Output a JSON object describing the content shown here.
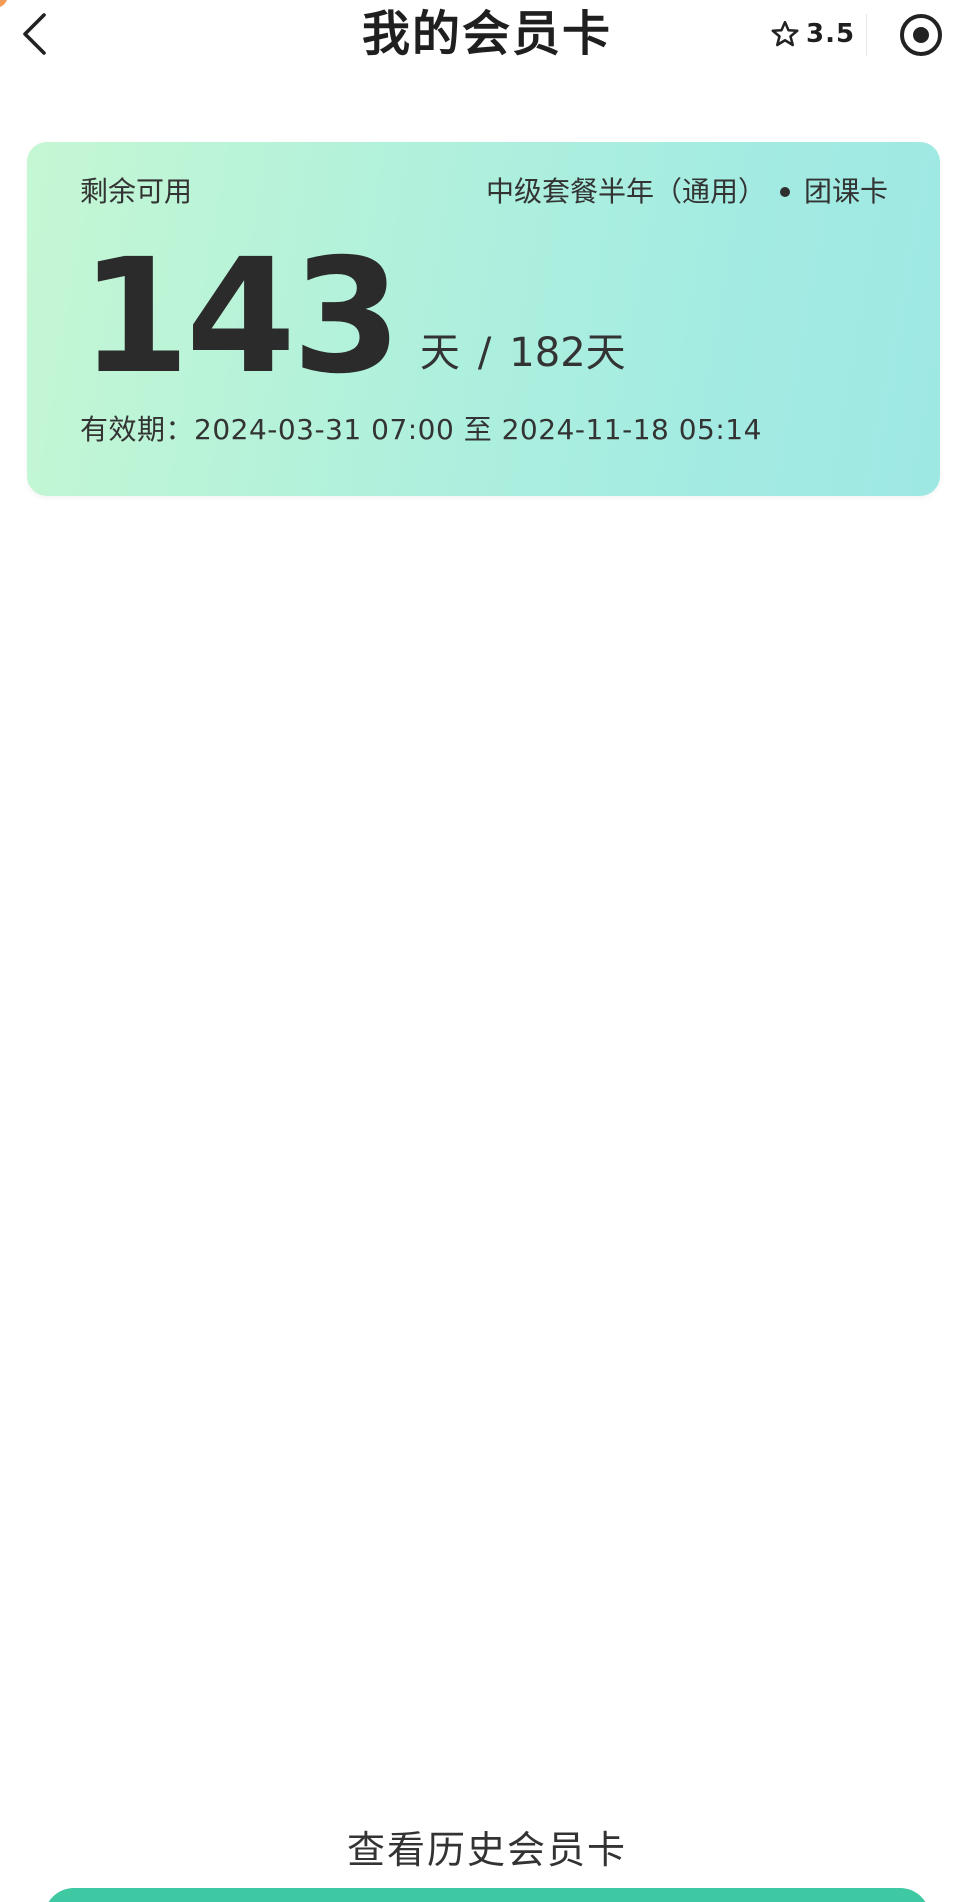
{
  "header": {
    "title": "我的会员卡",
    "back_icon": "chevron-left-icon",
    "rating_icon": "star-outline-icon",
    "rating_value": "3.5",
    "target_icon": "target-icon"
  },
  "card": {
    "label": "剩余可用",
    "plan_name": "中级套餐半年（通用）",
    "card_type": "团课卡",
    "days_remaining": "143",
    "days_unit": "天",
    "separator": "/",
    "days_total": "182天",
    "validity": "有效期：2024-03-31 07:00 至 2024-11-18 05:14"
  },
  "footer": {
    "history_link": "查看历史会员卡"
  },
  "colors": {
    "accent": "#3ec9a2",
    "card_gradient_start": "#c5f7d3",
    "card_gradient_end": "#9ee8e4",
    "text": "#2b2b2b"
  }
}
